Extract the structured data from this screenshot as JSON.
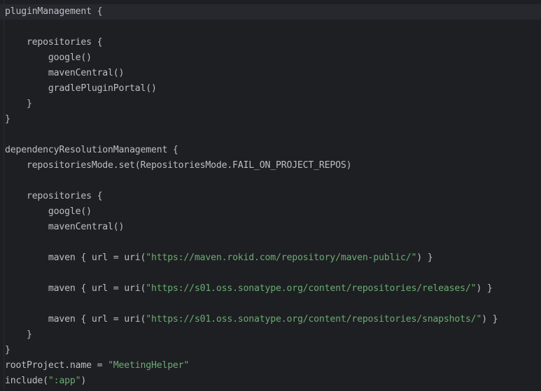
{
  "colors": {
    "background": "#1e1f22",
    "text": "#bcbec4",
    "string": "#6aab73",
    "current_line": "#26282e"
  },
  "code": {
    "l1": "pluginManagement {",
    "l3": "    repositories {",
    "l4": "        google()",
    "l5": "        mavenCentral()",
    "l6": "        gradlePluginPortal()",
    "l7": "    }",
    "l8": "}",
    "l10": "dependencyResolutionManagement {",
    "l11": "    repositoriesMode.set(RepositoriesMode.FAIL_ON_PROJECT_REPOS)",
    "l13": "    repositories {",
    "l14": "        google()",
    "l15": "        mavenCentral()",
    "l17a": "        maven { url = uri(",
    "l17s": "\"https://maven.rokid.com/repository/maven-public/\"",
    "l17b": ") }",
    "l19a": "        maven { url = uri(",
    "l19s": "\"https://s01.oss.sonatype.org/content/repositories/releases/\"",
    "l19b": ") }",
    "l21a": "        maven { url = uri(",
    "l21s": "\"https://s01.oss.sonatype.org/content/repositories/snapshots/\"",
    "l21b": ") }",
    "l22": "    }",
    "l23": "}",
    "l24a": "rootProject.name = ",
    "l24s": "\"MeetingHelper\"",
    "l25a": "include(",
    "l25s": "\":app\"",
    "l25b": ")"
  }
}
